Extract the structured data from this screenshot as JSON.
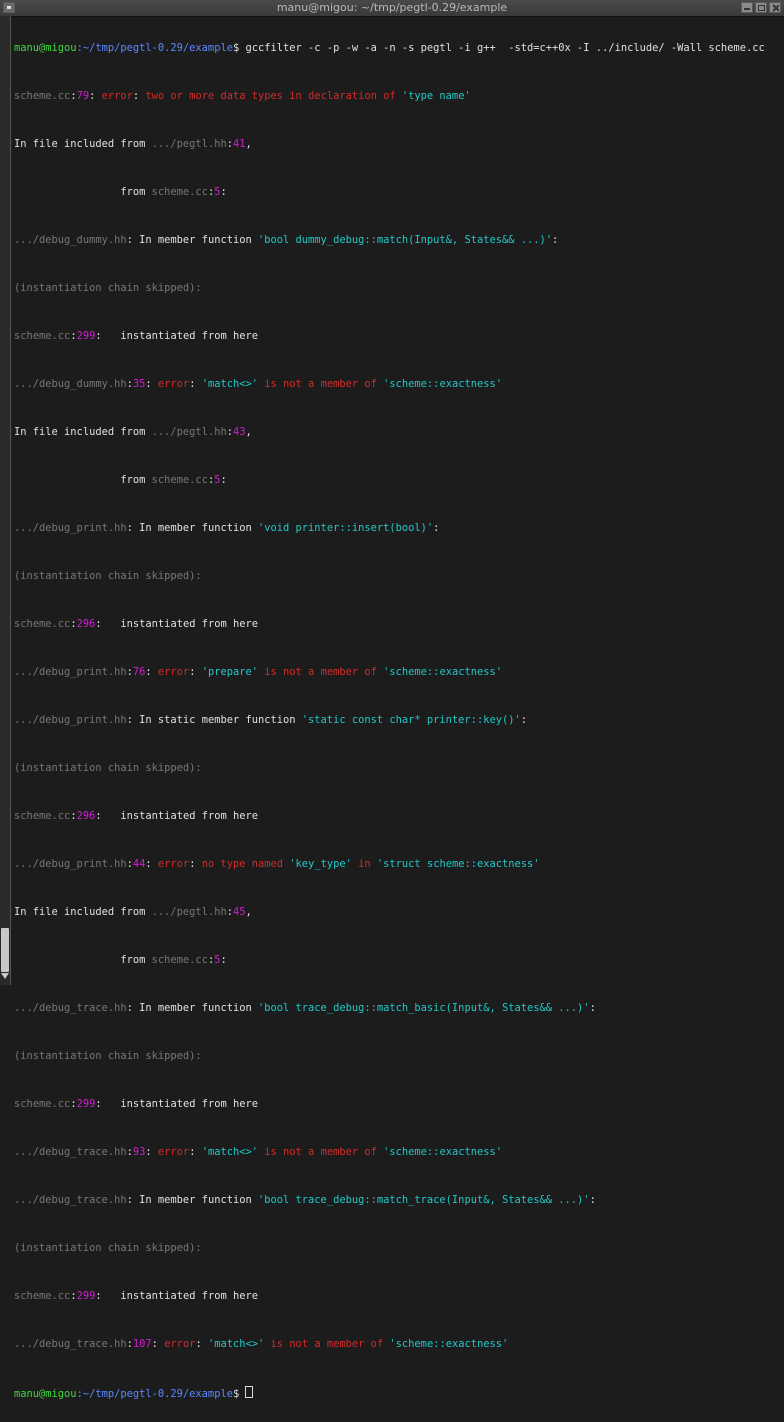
{
  "window": {
    "title": "manu@migou: ~/tmp/pegtl-0.29/example"
  },
  "colors": {
    "background": "#1c1c1c",
    "prompt_green": "#3fd63f",
    "path_blue": "#5a88ff",
    "file_gray": "#777777",
    "line_magenta": "#d21dd2",
    "error_red": "#d42a2a",
    "quote_cyan": "#23c8c8",
    "text_white": "#e0e0e0"
  },
  "terminal": {
    "command": {
      "user_host": "manu@migou",
      "path": ":~/tmp/pegtl-0.29/example",
      "symbol": "$",
      "text": " gccfilter -c -p -w -a -n -s pegtl -i g++  -std=c++0x -I ../include/ -Wall scheme.cc"
    },
    "l1": {
      "file": "scheme.cc",
      "line": "79",
      "err": "error",
      "msg": "two or more data types in declaration of ",
      "q": "'type name'"
    },
    "l2": {
      "pre": "In file included from ",
      "file": ".../pegtl.hh",
      "line": "41",
      "post": ","
    },
    "l3": {
      "pre": "                 from ",
      "file": "scheme.cc",
      "line": "5",
      "post": ":"
    },
    "l4": {
      "file": ".../debug_dummy.hh",
      "mid": " In member function ",
      "q": "'bool dummy_debug::match(Input&, States&& ...)'",
      "post": ":"
    },
    "l5": {
      "text": "(instantiation chain skipped):"
    },
    "l6": {
      "file": "scheme.cc",
      "line": "299",
      "post": "   instantiated from here"
    },
    "l7": {
      "file": ".../debug_dummy.hh",
      "line": "35",
      "err": "error",
      "q1": "'match<>'",
      "msg": " is not a member of ",
      "q2": "'scheme::exactness'"
    },
    "l8": {
      "pre": "In file included from ",
      "file": ".../pegtl.hh",
      "line": "43",
      "post": ","
    },
    "l9": {
      "pre": "                 from ",
      "file": "scheme.cc",
      "line": "5",
      "post": ":"
    },
    "l10": {
      "file": ".../debug_print.hh",
      "mid": " In member function ",
      "q": "'void printer::insert(bool)'",
      "post": ":"
    },
    "l11": {
      "text": "(instantiation chain skipped):"
    },
    "l12": {
      "file": "scheme.cc",
      "line": "296",
      "post": "   instantiated from here"
    },
    "l13": {
      "file": ".../debug_print.hh",
      "line": "76",
      "err": "error",
      "q1": "'prepare'",
      "msg": " is not a member of ",
      "q2": "'scheme::exactness'"
    },
    "l14": {
      "file": ".../debug_print.hh",
      "mid": " In static member function ",
      "q": "'static const char* printer::key()'",
      "post": ":"
    },
    "l15": {
      "text": "(instantiation chain skipped):"
    },
    "l16": {
      "file": "scheme.cc",
      "line": "296",
      "post": "   instantiated from here"
    },
    "l17": {
      "file": ".../debug_print.hh",
      "line": "44",
      "err": "error",
      "msg1": " no type named ",
      "q1": "'key_type'",
      "msg2": " in ",
      "q2": "'struct scheme::exactness'"
    },
    "l18": {
      "pre": "In file included from ",
      "file": ".../pegtl.hh",
      "line": "45",
      "post": ","
    },
    "l19": {
      "pre": "                 from ",
      "file": "scheme.cc",
      "line": "5",
      "post": ":"
    },
    "l20": {
      "file": ".../debug_trace.hh",
      "mid": " In member function ",
      "q": "'bool trace_debug::match_basic(Input&, States&& ...)'",
      "post": ":"
    },
    "l21": {
      "text": "(instantiation chain skipped):"
    },
    "l22": {
      "file": "scheme.cc",
      "line": "299",
      "post": "   instantiated from here"
    },
    "l23": {
      "file": ".../debug_trace.hh",
      "line": "93",
      "err": "error",
      "q1": "'match<>'",
      "msg": " is not a member of ",
      "q2": "'scheme::exactness'"
    },
    "l24": {
      "file": ".../debug_trace.hh",
      "mid": " In member function ",
      "q": "'bool trace_debug::match_trace(Input&, States&& ...)'",
      "post": ":"
    },
    "l25": {
      "text": "(instantiation chain skipped):"
    },
    "l26": {
      "file": "scheme.cc",
      "line": "299",
      "post": "   instantiated from here"
    },
    "l27": {
      "file": ".../debug_trace.hh",
      "line": "107",
      "err": "error",
      "q1": "'match<>'",
      "msg": " is not a member of ",
      "q2": "'scheme::exactness'"
    },
    "prompt": {
      "user_host": "manu@migou",
      "path": ":~/tmp/pegtl-0.29/example",
      "symbol": "$ "
    }
  }
}
